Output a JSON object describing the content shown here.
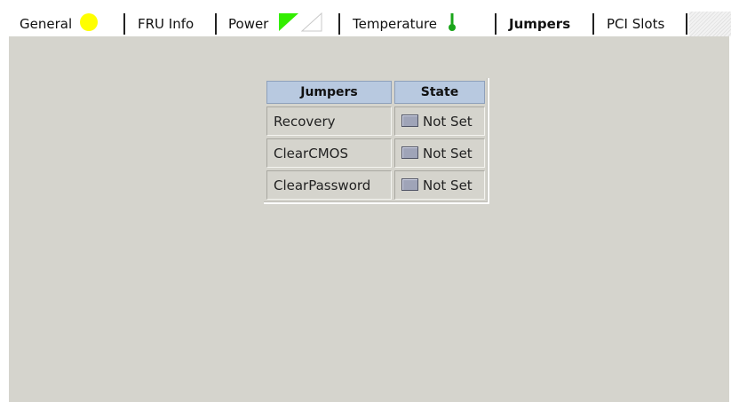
{
  "tabs": [
    {
      "label": "General",
      "icon": "yellow-circle-icon",
      "active": false
    },
    {
      "label": "FRU Info",
      "icon": null,
      "active": false
    },
    {
      "label": "Power",
      "icon": "power-triangles-icon",
      "active": false
    },
    {
      "label": "Temperature",
      "icon": "thermometer-icon",
      "active": false
    },
    {
      "label": "Jumpers",
      "icon": null,
      "active": true
    },
    {
      "label": "PCI Slots",
      "icon": null,
      "active": false
    }
  ],
  "table": {
    "headers": {
      "name": "Jumpers",
      "state": "State"
    },
    "rows": [
      {
        "name": "Recovery",
        "state": "Not Set"
      },
      {
        "name": "ClearCMOS",
        "state": "Not Set"
      },
      {
        "name": "ClearPassword",
        "state": "Not Set"
      }
    ]
  },
  "colors": {
    "panel_bg": "#d5d4cd",
    "header_bg": "#b8c9e0",
    "status_yellow": "#ffff00",
    "power_green": "#33ee00",
    "thermo_green": "#1aa51a"
  }
}
